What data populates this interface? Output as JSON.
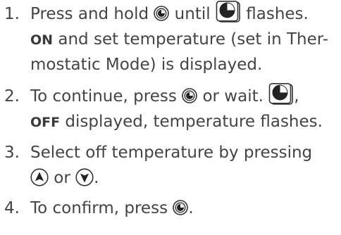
{
  "steps": [
    {
      "number": "1.",
      "lines": [
        [
          "Press and hold ",
          {
            "icon": "mode-button-icon"
          },
          " until ",
          {
            "icon": "timer-display-icon"
          },
          " flashes."
        ],
        [
          {
            "bold": "ON"
          },
          " and set temperature (set in Ther-"
        ],
        [
          "mostatic Mode) is displayed."
        ]
      ]
    },
    {
      "number": "2.",
      "lines": [
        [
          "To continue, press ",
          {
            "icon": "mode-button-icon"
          },
          " or wait. ",
          {
            "icon": "timer-display-icon"
          },
          ","
        ],
        [
          {
            "bold": "OFF"
          },
          " displayed, temperature flashes."
        ]
      ]
    },
    {
      "number": "3.",
      "lines": [
        [
          "Select off temperature by pressing"
        ],
        [
          {
            "icon": "up-arrow-button-icon"
          },
          " or ",
          {
            "icon": "down-arrow-button-icon"
          },
          "."
        ]
      ]
    },
    {
      "number": "4.",
      "lines": [
        [
          "To confirm, press ",
          {
            "icon": "mode-button-icon"
          },
          "."
        ]
      ]
    }
  ]
}
